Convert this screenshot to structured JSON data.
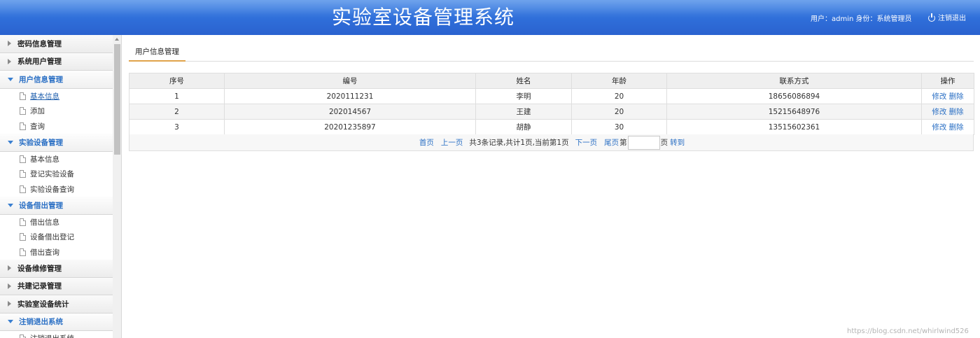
{
  "header": {
    "title": "实验室设备管理系统",
    "user_info": "用户：admin 身份：系统管理员",
    "logout_label": "注销退出"
  },
  "sidebar": {
    "groups": [
      {
        "label": "密码信息管理",
        "open": false,
        "items": []
      },
      {
        "label": "系统用户管理",
        "open": false,
        "items": []
      },
      {
        "label": "用户信息管理",
        "open": true,
        "items": [
          "基本信息",
          "添加",
          "查询"
        ]
      },
      {
        "label": "实验设备管理",
        "open": true,
        "items": [
          "基本信息",
          "登记实验设备",
          "实验设备查询"
        ]
      },
      {
        "label": "设备借出管理",
        "open": true,
        "items": [
          "借出信息",
          "设备借出登记",
          "借出查询"
        ]
      },
      {
        "label": "设备维修管理",
        "open": false,
        "items": []
      },
      {
        "label": "共建记录管理",
        "open": false,
        "items": []
      },
      {
        "label": "实验室设备统计",
        "open": false,
        "items": []
      },
      {
        "label": "注销退出系统",
        "open": true,
        "items": [
          "注销退出系统"
        ]
      }
    ],
    "active_item": "基本信息"
  },
  "main": {
    "tab_label": "用户信息管理",
    "table": {
      "columns": [
        "序号",
        "编号",
        "姓名",
        "年龄",
        "联系方式",
        "操作"
      ],
      "rows": [
        {
          "seq": "1",
          "code": "2020111231",
          "name": "李明",
          "age": "20",
          "contact": "18656086894"
        },
        {
          "seq": "2",
          "code": "202014567",
          "name": "王建",
          "age": "20",
          "contact": "15215648976"
        },
        {
          "seq": "3",
          "code": "20201235897",
          "name": "胡静",
          "age": "30",
          "contact": "13515602361"
        }
      ],
      "edit_label": "修改",
      "delete_label": "删除"
    },
    "pager": {
      "first": "首页",
      "prev": "上一页",
      "summary": "共3条记录,共计1页,当前第1页",
      "next": "下一页",
      "last": "尾页",
      "page_prefix": "第",
      "page_suffix": "页",
      "goto": "转到"
    }
  },
  "watermark": "https://blog.csdn.net/whirlwind526"
}
